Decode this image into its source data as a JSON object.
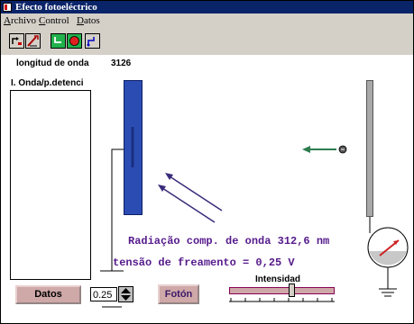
{
  "window": {
    "title": "Efecto fotoeléctrico"
  },
  "menu": [
    "Archivo",
    "Control",
    "Datos"
  ],
  "toolbar": {
    "icons": [
      "cursor-step-icon",
      "wrench-icon",
      "clock-icon",
      "stop-icon",
      "start-icon"
    ]
  },
  "readout": {
    "label": "longitud de onda",
    "value": "3126"
  },
  "list": {
    "header": "I. Onda/p.detenci"
  },
  "messages": {
    "radiation": "Radiação comp. de onda 312,6 nm",
    "voltage": "tensão de freamento = 0,25 V"
  },
  "controls": {
    "datos_label": "Datos",
    "spinner_value": "0.25",
    "foton_label": "Fotón",
    "intensity_label": "Intensidad",
    "intensity_level": 0.6
  },
  "colors": {
    "left_plate": "#2b4db3",
    "electron_arrow": "#2e7d4f",
    "photon_arrows": "#3a2a7a",
    "message_text": "#551a8b",
    "meter_needle": "#cc2222"
  }
}
